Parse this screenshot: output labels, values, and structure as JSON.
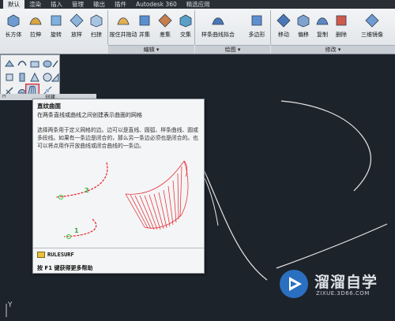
{
  "ribbon_tabs": [
    {
      "label": "默认",
      "active": true
    },
    {
      "label": "渲染"
    },
    {
      "label": "插入"
    },
    {
      "label": "管理"
    },
    {
      "label": "输出"
    },
    {
      "label": "插件"
    },
    {
      "label": "Autodesk 360"
    },
    {
      "label": "精选应用"
    }
  ],
  "ribbon": {
    "buttons": [
      {
        "label": "长方体",
        "icon": "box-icon"
      },
      {
        "label": "拉伸",
        "icon": "extrude-icon"
      },
      {
        "label": "旋转",
        "icon": "revolve-icon"
      },
      {
        "label": "放样",
        "icon": "loft-icon"
      },
      {
        "label": "扫掠",
        "icon": "sweep-icon"
      },
      {
        "label": "按住并拖动",
        "icon": "presspull-icon"
      },
      {
        "label": "并集",
        "icon": "union-icon"
      },
      {
        "label": "差集",
        "icon": "subtract-icon"
      },
      {
        "label": "交集",
        "icon": "intersect-icon"
      },
      {
        "label": "样条曲线拟合",
        "icon": "spline-icon"
      },
      {
        "label": "多边形",
        "icon": "polygon-icon"
      },
      {
        "label": "移动",
        "icon": "move-icon"
      },
      {
        "label": "偏移",
        "icon": "offset-icon"
      },
      {
        "label": "复制",
        "icon": "copy-icon"
      },
      {
        "label": "删除",
        "icon": "erase-icon"
      },
      {
        "label": "三维镜像",
        "icon": "mirror3d-icon"
      }
    ],
    "groups": {
      "edit": "编辑 ▾",
      "draw": "绘图 ▾",
      "modify": "修改 ▾"
    }
  },
  "gallery": {
    "footer_label": "创建",
    "selected_tool": "rulesurf"
  },
  "tooltip": {
    "title": "直纹曲面",
    "description": "在两条直线或曲线之间创建表示曲面的网格",
    "body": "选择两条用于定义网格的边。边可以是直线、圆弧、样条曲线、圆或多段线。如果有一条边是闭合的，那么另一条边必须也是闭合的。也可以将点用作开放曲线或闭合曲线的一条边。",
    "label_1": "1",
    "label_2": "2",
    "command": "RULESURF",
    "help": "按 F1 键获得更多帮助"
  },
  "watermark": {
    "name": "溜溜自学",
    "url": "ZIXUE.3D66.COM"
  },
  "ucs": {
    "axis_label": "Y"
  },
  "colors": {
    "canvas": "#1d232b",
    "curve": "#e8e8e8",
    "surface": "#e8202a",
    "highlight": "#e0262c",
    "pick": "#39d04a"
  }
}
